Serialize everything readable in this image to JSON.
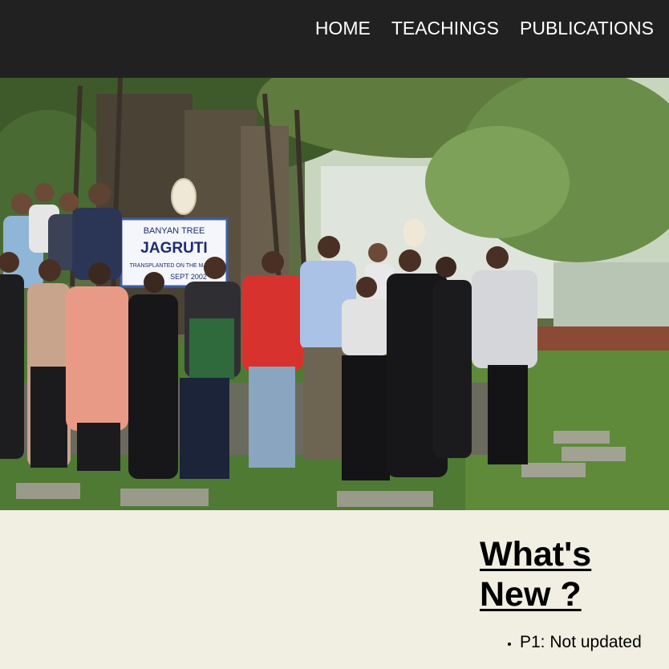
{
  "nav": {
    "items": [
      {
        "label": "HOME"
      },
      {
        "label": "TEACHINGS"
      },
      {
        "label": "PUBLICATIONS"
      }
    ]
  },
  "hero": {
    "sign": {
      "line1": "BANYAN  TREE",
      "line2": "JAGRUTI",
      "line3": "TRANSPLANTED ON THE MAIN G",
      "line4": "SEPT 2002"
    }
  },
  "whats_new": {
    "title_line1": "What's",
    "title_line2": "New ?",
    "items": [
      {
        "text": "P1: Not updated"
      }
    ]
  },
  "colors": {
    "navbar_bg": "#212121",
    "nav_text": "#ffffff",
    "content_bg": "#f0efe2"
  }
}
